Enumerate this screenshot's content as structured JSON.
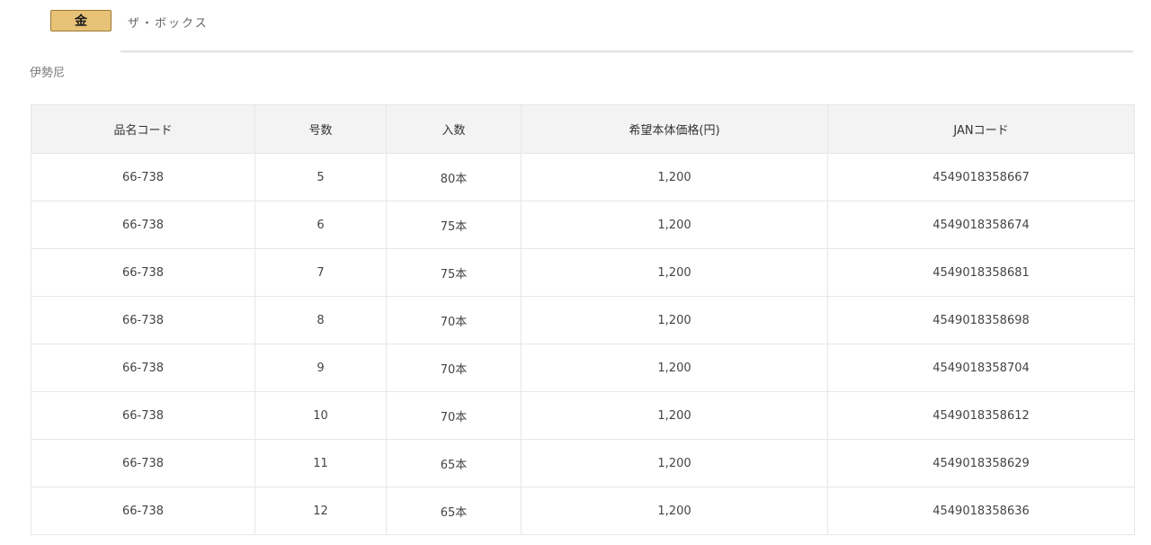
{
  "header": {
    "badge_label": "金",
    "product_name": "ザ・ボックス"
  },
  "maker": "伊勢尼",
  "table": {
    "columns": [
      "品名コード",
      "号数",
      "入数",
      "希望本体価格(円)",
      "JANコード"
    ],
    "rows": [
      [
        "66-738",
        "5",
        "80本",
        "1,200",
        "4549018358667"
      ],
      [
        "66-738",
        "6",
        "75本",
        "1,200",
        "4549018358674"
      ],
      [
        "66-738",
        "7",
        "75本",
        "1,200",
        "4549018358681"
      ],
      [
        "66-738",
        "8",
        "70本",
        "1,200",
        "4549018358698"
      ],
      [
        "66-738",
        "9",
        "70本",
        "1,200",
        "4549018358704"
      ],
      [
        "66-738",
        "10",
        "70本",
        "1,200",
        "4549018358612"
      ],
      [
        "66-738",
        "11",
        "65本",
        "1,200",
        "4549018358629"
      ],
      [
        "66-738",
        "12",
        "65本",
        "1,200",
        "4549018358636"
      ]
    ]
  },
  "colors": {
    "badge_fill": "#e7c277",
    "badge_border": "#9a7a33",
    "header_row_bg": "#f3f3f3",
    "cell_border": "#e6e6e6"
  }
}
